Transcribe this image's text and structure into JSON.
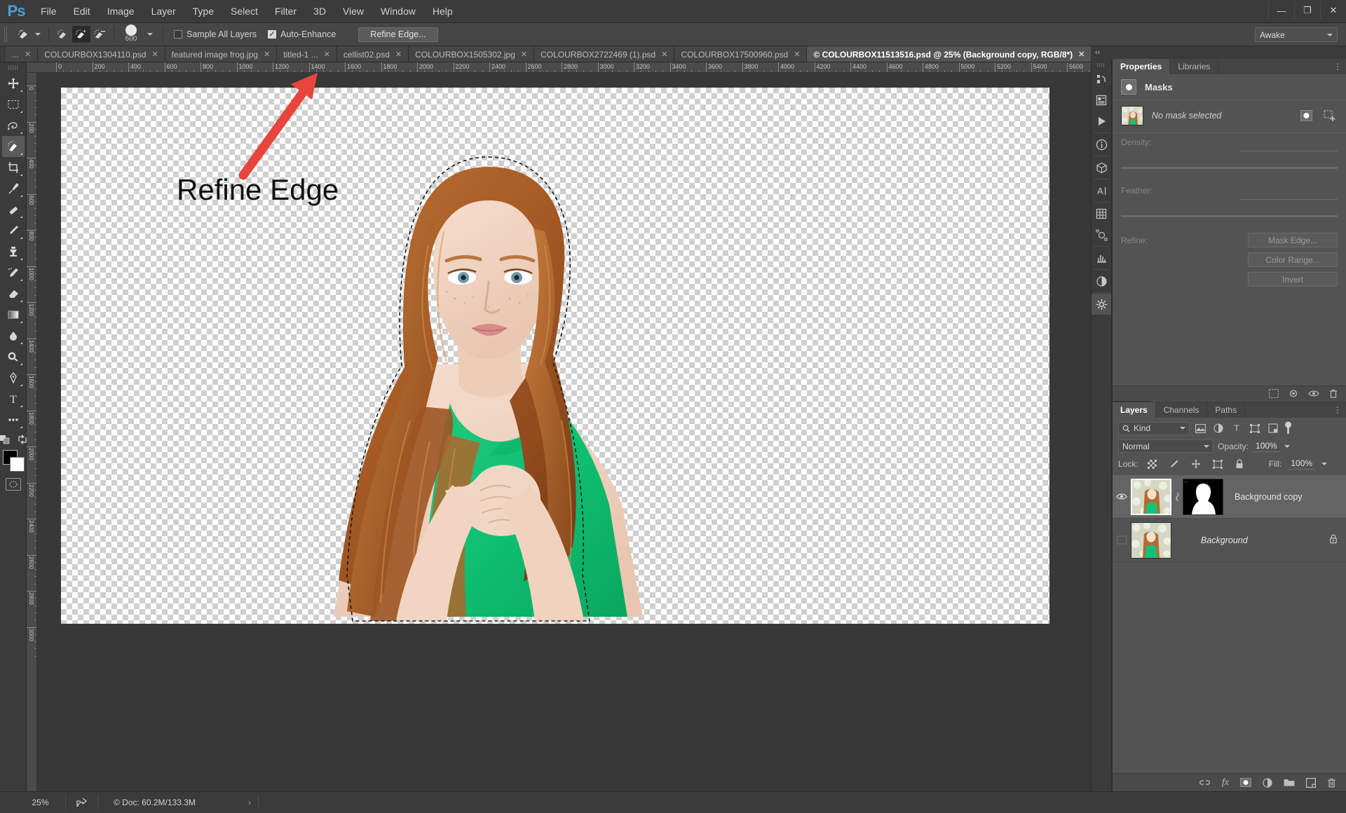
{
  "app": {
    "name": "Adobe Photoshop",
    "logo": "Ps"
  },
  "menubar": {
    "items": [
      {
        "label": "File"
      },
      {
        "label": "Edit"
      },
      {
        "label": "Image"
      },
      {
        "label": "Layer"
      },
      {
        "label": "Type"
      },
      {
        "label": "Select"
      },
      {
        "label": "Filter"
      },
      {
        "label": "3D"
      },
      {
        "label": "View"
      },
      {
        "label": "Window"
      },
      {
        "label": "Help"
      }
    ],
    "window_controls": [
      {
        "name": "minimize",
        "glyph": "—"
      },
      {
        "name": "maximize",
        "glyph": "❐"
      },
      {
        "name": "close",
        "glyph": "✕"
      }
    ]
  },
  "options_bar": {
    "tool_name": "quick-selection-tool",
    "modes": [
      {
        "name": "new-selection",
        "active": false
      },
      {
        "name": "add-to-selection",
        "active": true
      },
      {
        "name": "subtract-from-selection",
        "active": false
      }
    ],
    "brush_size": "600",
    "sample_all_layers": {
      "label": "Sample All Layers",
      "checked": false
    },
    "auto_enhance": {
      "label": "Auto-Enhance",
      "checked": true
    },
    "refine_edge_button": "Refine Edge...",
    "workspace_select": {
      "value": "Awake"
    }
  },
  "tabs": {
    "overflow_label": "»",
    "items": [
      {
        "label": "...",
        "active": false
      },
      {
        "label": "COLOURBOX1304110.psd",
        "active": false
      },
      {
        "label": "featured image frog.jpg",
        "active": false
      },
      {
        "label": "titled-1 ...",
        "active": false
      },
      {
        "label": "cellist02.psd",
        "active": false
      },
      {
        "label": "COLOURBOX1505302.jpg",
        "active": false
      },
      {
        "label": "COLOURBOX2722469 (1).psd",
        "active": false
      },
      {
        "label": "COLOURBOX17500960.psd",
        "active": false
      },
      {
        "label": "© COLOURBOX11513516.psd @ 25% (Background copy, RGB/8*)",
        "active": true
      }
    ]
  },
  "toolbar": {
    "tools": [
      {
        "name": "move-tool",
        "glyph": "✥",
        "active": false
      },
      {
        "name": "rectangular-marquee-tool",
        "glyph": "▭",
        "active": false
      },
      {
        "name": "lasso-tool",
        "glyph": "✒",
        "active": false
      },
      {
        "name": "quick-selection-tool",
        "glyph": "◗",
        "active": true
      },
      {
        "name": "crop-tool",
        "glyph": "⌗",
        "active": false
      },
      {
        "name": "eyedropper-tool",
        "glyph": "✐",
        "active": false
      },
      {
        "name": "spot-healing-brush-tool",
        "glyph": "✚",
        "active": false
      },
      {
        "name": "brush-tool",
        "glyph": "✎",
        "active": false
      },
      {
        "name": "clone-stamp-tool",
        "glyph": "⊓",
        "active": false
      },
      {
        "name": "history-brush-tool",
        "glyph": "❧",
        "active": false
      },
      {
        "name": "eraser-tool",
        "glyph": "◣",
        "active": false
      },
      {
        "name": "gradient-tool",
        "glyph": "▦",
        "active": false
      },
      {
        "name": "blur-tool",
        "glyph": "💧",
        "active": false
      },
      {
        "name": "dodge-tool",
        "glyph": "●",
        "active": false
      },
      {
        "name": "pen-tool",
        "glyph": "✑",
        "active": false
      },
      {
        "name": "horizontal-type-tool",
        "glyph": "T",
        "active": false
      },
      {
        "name": "more-tools",
        "glyph": "•••",
        "active": false
      }
    ],
    "colors": {
      "foreground": "#000000",
      "background": "#ffffff"
    },
    "quick_mask_label": "quick-mask-mode"
  },
  "canvas": {
    "annotation_text": "Refine Edge",
    "arrow_color": "#e8453c",
    "zoom": "25%",
    "ruler_h_labels": [
      "0",
      "200",
      "400",
      "600",
      "800",
      "1000",
      "1200",
      "1400",
      "1600",
      "1800",
      "2000",
      "2200",
      "2400",
      "2600",
      "2800",
      "3000",
      "3200",
      "3400",
      "3600",
      "3800",
      "4000",
      "4200",
      "4400",
      "4600",
      "4800",
      "5000",
      "5200",
      "5400",
      "5600"
    ],
    "ruler_v_labels": [
      "2",
      "0",
      "2",
      "0",
      "4",
      "0",
      "0",
      "6",
      "0",
      "0",
      "8",
      "0",
      "0",
      "1",
      "0",
      "0",
      "0",
      "1",
      "2",
      "0",
      "0",
      "1",
      "4",
      "0",
      "0",
      "1",
      "6",
      "0",
      "0",
      "1",
      "8",
      "0",
      "0",
      "2",
      "0",
      "0",
      "0",
      "2",
      "2",
      "0",
      "0",
      "2",
      "4",
      "0",
      "0",
      "2",
      "6",
      "0",
      "0",
      "2",
      "8",
      "0",
      "0"
    ]
  },
  "properties_panel": {
    "tabs": [
      {
        "label": "Properties",
        "active": true
      },
      {
        "label": "Libraries",
        "active": false
      }
    ],
    "section_title": "Masks",
    "mask_status": "No mask selected",
    "density": {
      "label": "Density:",
      "value": ""
    },
    "feather": {
      "label": "Feather:",
      "value": ""
    },
    "refine": {
      "label": "Refine:",
      "buttons": [
        {
          "label": "Mask Edge..."
        },
        {
          "label": "Color Range..."
        },
        {
          "label": "Invert"
        }
      ]
    },
    "footer_icons": [
      {
        "name": "load-selection-icon",
        "glyph": "⬚"
      },
      {
        "name": "apply-mask-icon",
        "glyph": "◉"
      },
      {
        "name": "toggle-mask-icon",
        "glyph": "👁"
      },
      {
        "name": "delete-mask-icon",
        "glyph": "🗑"
      }
    ]
  },
  "layers_panel": {
    "tabs": [
      {
        "label": "Layers",
        "active": true
      },
      {
        "label": "Channels",
        "active": false
      },
      {
        "label": "Paths",
        "active": false
      }
    ],
    "filter": {
      "kind_label": "Kind",
      "icons": [
        {
          "name": "filter-pixel-icon",
          "glyph": "▤"
        },
        {
          "name": "filter-adjustment-icon",
          "glyph": "◐"
        },
        {
          "name": "filter-type-icon",
          "glyph": "T"
        },
        {
          "name": "filter-shape-icon",
          "glyph": "⬚"
        },
        {
          "name": "filter-smart-object-icon",
          "glyph": "▣"
        }
      ],
      "toggle_name": "filter-toggle"
    },
    "blend_mode": "Normal",
    "opacity": {
      "label": "Opacity:",
      "value": "100%"
    },
    "fill": {
      "label": "Fill:",
      "value": "100%"
    },
    "lock": {
      "label": "Lock:",
      "icons": [
        {
          "name": "lock-transparent-pixels-icon",
          "glyph": "▨"
        },
        {
          "name": "lock-image-pixels-icon",
          "glyph": "✎"
        },
        {
          "name": "lock-position-icon",
          "glyph": "✥"
        },
        {
          "name": "lock-artboard-icon",
          "glyph": "⬚"
        },
        {
          "name": "lock-all-icon",
          "glyph": "🔒"
        }
      ]
    },
    "layers": [
      {
        "name": "Background copy",
        "visible": true,
        "selected": true,
        "has_mask": true,
        "locked": false,
        "italic": false
      },
      {
        "name": "Background",
        "visible": false,
        "selected": false,
        "has_mask": false,
        "locked": true,
        "italic": true
      }
    ],
    "footer_icons": [
      {
        "name": "link-layers-icon",
        "glyph": "⛓"
      },
      {
        "name": "layer-style-icon",
        "glyph": "fx"
      },
      {
        "name": "add-layer-mask-icon",
        "glyph": "◉"
      },
      {
        "name": "new-adjustment-layer-icon",
        "glyph": "◐"
      },
      {
        "name": "new-group-icon",
        "glyph": "🗀"
      },
      {
        "name": "new-layer-icon",
        "glyph": "🗋"
      },
      {
        "name": "delete-layer-icon",
        "glyph": "🗑"
      }
    ]
  },
  "status_bar": {
    "zoom": "25%",
    "share_icon": "share-icon",
    "doc_info": "© Doc: 60.2M/133.3M",
    "expand_glyph": "›"
  },
  "rail_icons": [
    {
      "name": "history-icon",
      "glyph": "↺",
      "active": false
    },
    {
      "name": "notes-icon",
      "glyph": "▤",
      "active": false
    },
    {
      "name": "actions-icon",
      "glyph": "▶",
      "active": false
    },
    {
      "name": "info-icon",
      "glyph": "ⓘ",
      "active": false
    },
    {
      "name": "3d-icon",
      "glyph": "⬡",
      "active": false
    },
    {
      "name": "character-icon",
      "glyph": "A",
      "active": false
    },
    {
      "name": "swatches-icon",
      "glyph": "▦",
      "active": false
    },
    {
      "name": "paths-icon",
      "glyph": "✧",
      "active": false
    },
    {
      "name": "histogram-icon",
      "glyph": "⊿",
      "active": false
    },
    {
      "name": "adjustments-icon",
      "glyph": "◑",
      "active": false
    },
    {
      "name": "properties-icon",
      "glyph": "✿",
      "active": true
    }
  ]
}
